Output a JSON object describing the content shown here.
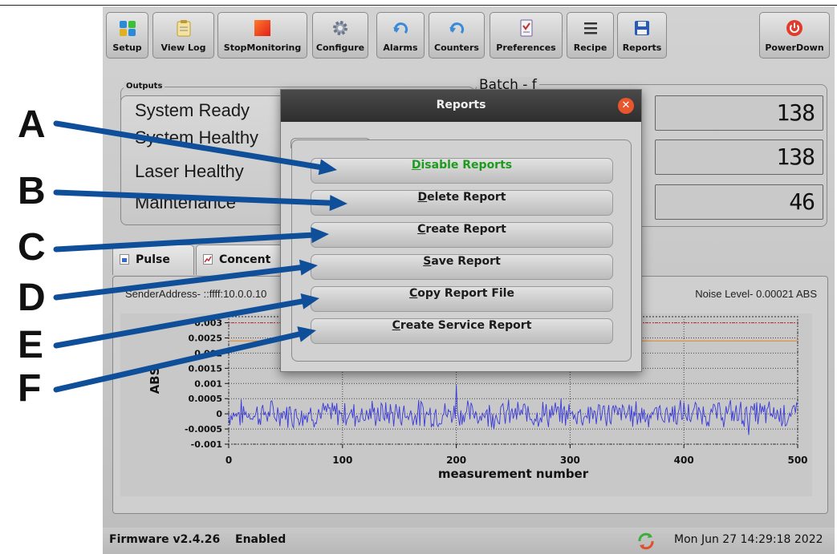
{
  "toolbar": {
    "buttons": [
      {
        "label": "Setup",
        "icon": "setup-icon"
      },
      {
        "label": "View Log",
        "icon": "clipboard-icon"
      },
      {
        "label": "StopMonitoring",
        "icon": "stop-square-icon"
      },
      {
        "label": "Configure",
        "icon": "gear-icon"
      },
      {
        "label": "Alarms",
        "icon": "undo-arrow-icon"
      },
      {
        "label": "Counters",
        "icon": "undo-arrow-icon"
      },
      {
        "label": "Preferences",
        "icon": "checklist-icon"
      },
      {
        "label": "Recipe",
        "icon": "hamburger-menu-icon"
      },
      {
        "label": "Reports",
        "icon": "floppy-disk-icon"
      },
      {
        "label": "PowerDown",
        "icon": "power-icon"
      }
    ]
  },
  "outputs": {
    "title": "Outputs",
    "items": [
      "System Ready",
      "System Healthy",
      "Laser Healthy",
      "Maintenance"
    ]
  },
  "batch": {
    "title": "Batch - f",
    "counters": [
      "138",
      "138",
      "46"
    ]
  },
  "tabs": [
    "Pulse",
    "Concent"
  ],
  "plot": {
    "sender_address": "SenderAddress- ::ffff:10.0.0.10",
    "noise_level": "Noise Level- 0.00021 ABS"
  },
  "chart_data": {
    "type": "line",
    "xlabel": "measurement number",
    "ylabel": "ABS",
    "xlim": [
      0,
      500
    ],
    "ylim": [
      -0.001,
      0.0032
    ],
    "x_ticks": [
      "0",
      "100",
      "200",
      "300",
      "400",
      "500"
    ],
    "y_ticks": [
      "0.003",
      "0.0025",
      "0.002",
      "0.0015",
      "0.001",
      "0.0005",
      "0",
      "-0.0005",
      "-0.001"
    ],
    "reference_lines": [
      {
        "y": 0.003,
        "color": "#d43030",
        "style": "dotted"
      },
      {
        "y": 0.0024,
        "color": "#e09040",
        "style": "solid"
      }
    ],
    "series": [
      {
        "color": "#3a3ad8",
        "description": "noise signal fluctuating around 0 between about -0.0006 and 0.0006 for 500 measurements"
      }
    ]
  },
  "status": {
    "firmware": "Firmware v2.4.26",
    "state": "Enabled",
    "datetime": "Mon Jun 27 14:29:18 2022"
  },
  "dialog": {
    "title": "Reports",
    "buttons": [
      {
        "mnemonic": "D",
        "rest": "isable Reports"
      },
      {
        "mnemonic": "D",
        "rest": "elete Report"
      },
      {
        "mnemonic": "C",
        "rest": "reate Report"
      },
      {
        "mnemonic": "S",
        "rest": "ave Report"
      },
      {
        "mnemonic": "C",
        "rest": "opy Report File"
      },
      {
        "mnemonic": "C",
        "rest": "reate Service Report"
      }
    ]
  },
  "annotations": [
    "A",
    "B",
    "C",
    "D",
    "E",
    "F"
  ],
  "colors": {
    "arrow": "#0f4f9a",
    "enabled_text": "#1e9a1e",
    "close_button": "#e9562d",
    "power_button": "#e23b2b"
  }
}
